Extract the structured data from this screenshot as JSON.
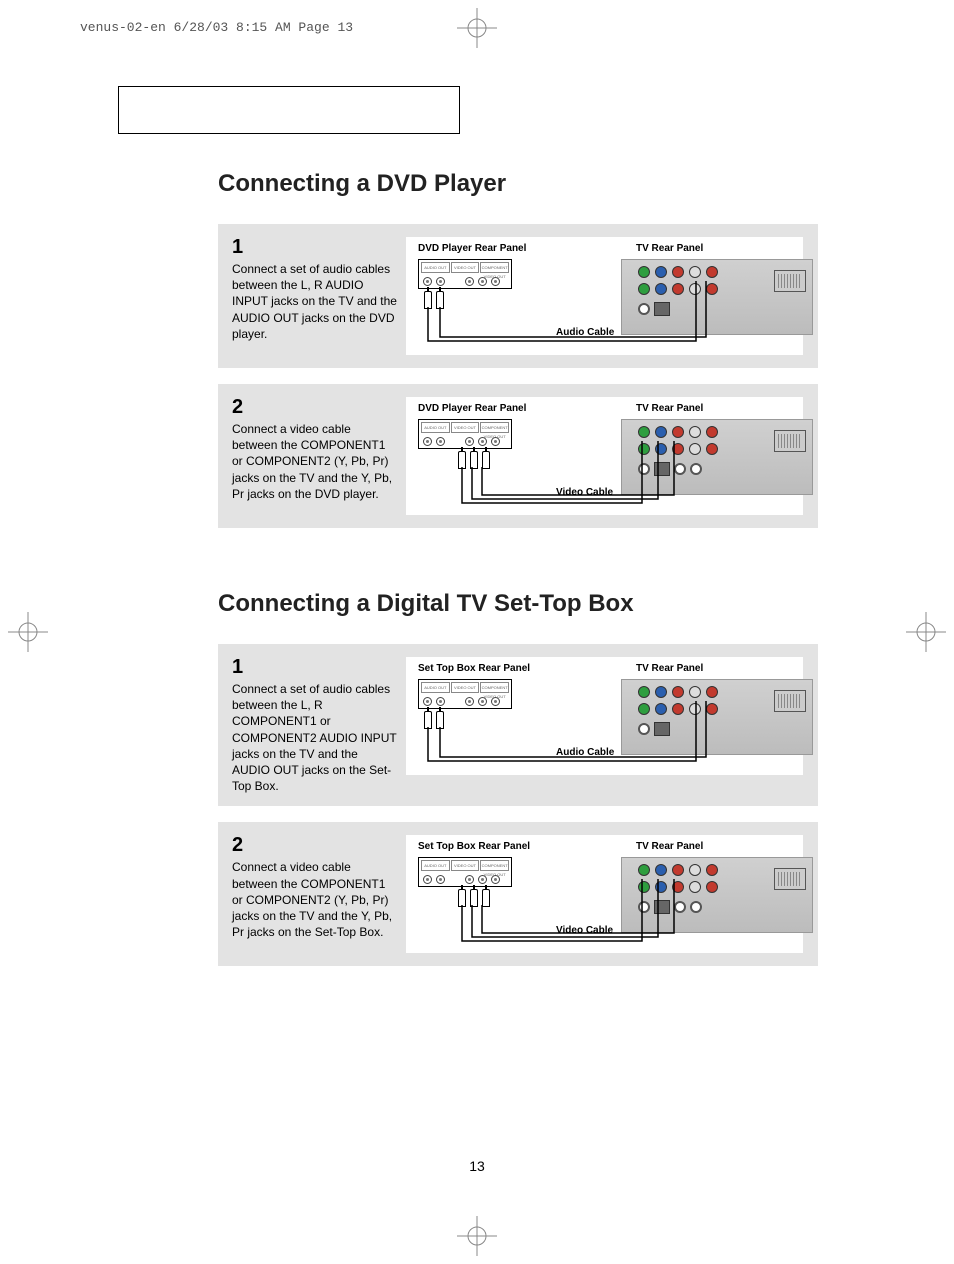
{
  "slug": "venus-02-en  6/28/03 8:15 AM  Page 13",
  "page_number": "13",
  "sections": [
    {
      "heading": "Connecting a DVD Player",
      "steps": [
        {
          "num": "1",
          "text": "Connect a set of audio cables between the L, R AUDIO INPUT jacks on the TV and the AUDIO OUT jacks on the DVD player.",
          "source_label": "DVD Player Rear Panel",
          "tv_label": "TV Rear Panel",
          "cable_label": "Audio Cable"
        },
        {
          "num": "2",
          "text": "Connect a video cable between the COMPONENT1 or COMPONENT2 (Y, Pb, Pr) jacks on the TV and the Y, Pb, Pr jacks on the DVD player.",
          "source_label": "DVD Player Rear Panel",
          "tv_label": "TV Rear Panel",
          "cable_label": "Video Cable"
        }
      ]
    },
    {
      "heading": "Connecting a Digital TV Set-Top Box",
      "steps": [
        {
          "num": "1",
          "text": "Connect a set of audio cables between the L, R COMPONENT1 or COMPONENT2 AUDIO INPUT jacks on the TV and the AUDIO OUT jacks on the Set-Top Box.",
          "source_label": "Set Top Box Rear Panel",
          "tv_label": "TV Rear Panel",
          "cable_label": "Audio Cable"
        },
        {
          "num": "2",
          "text": "Connect a video cable between the COMPONENT1 or COMPONENT2 (Y, Pb, Pr) jacks on the TV and the Y, Pb, Pr jacks on the Set-Top Box.",
          "source_label": "Set Top Box Rear Panel",
          "tv_label": "TV Rear Panel",
          "cable_label": "Video Cable"
        }
      ]
    }
  ]
}
